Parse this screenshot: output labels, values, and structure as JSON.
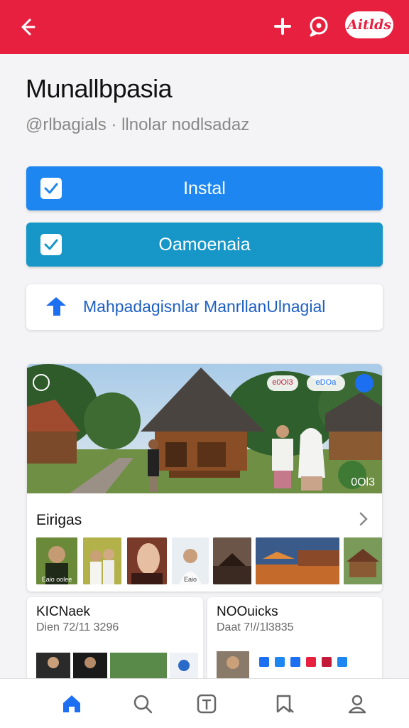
{
  "topbar": {
    "badge_label": "Aitlds",
    "colors": {
      "bar": "#e8203f"
    },
    "icons": [
      "back-arrow-icon",
      "plus-icon",
      "chat-bubble-icon"
    ]
  },
  "header": {
    "title": "Munallbpasia",
    "subtitle": "@rlbagials · llnolar nodlsadaz"
  },
  "actions": {
    "install_label": "Instal",
    "second_label": "Oamoenaia",
    "link_label": "Mahpadagisnlar ManrllanUlnagial"
  },
  "media": {
    "overlay_badges": [
      "e0Ol3",
      "eDOa"
    ],
    "duration": "0Ol3",
    "section_title": "Eirigas",
    "thumb_captions": [
      "Eaio oolee",
      "",
      "",
      "Eaio"
    ]
  },
  "cards": [
    {
      "title": "KICNaek",
      "date": "Dien 72/11 3296"
    },
    {
      "title": "NOOuicks",
      "date": "Daat 7!//1l3835"
    }
  ],
  "tabbar": {
    "tabs": [
      "home-icon",
      "search-icon",
      "text-icon",
      "bookmark-icon",
      "profile-icon"
    ],
    "active": "home-icon",
    "colors": {
      "active": "#1d6ff2",
      "inactive": "#666666"
    }
  }
}
